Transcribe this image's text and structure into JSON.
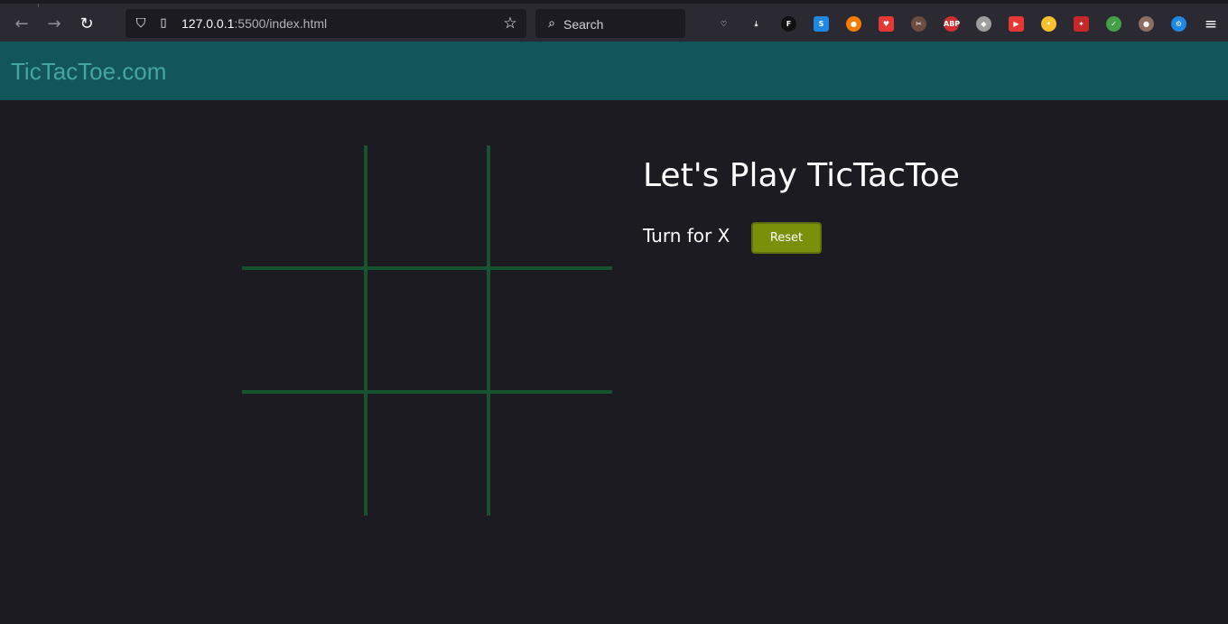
{
  "browser": {
    "url_host": "127.0.0.1",
    "url_path": ":5500/index.html",
    "search_placeholder": "Search",
    "back_glyph": "←",
    "forward_glyph": "→",
    "reload_glyph": "↻",
    "menu_glyph": "≡",
    "star_glyph": "☆",
    "search_glyph": "⌕",
    "extensions": [
      {
        "name": "pocket-icon",
        "label": "♡",
        "color": "#2b2a33"
      },
      {
        "name": "download-icon",
        "label": "⤓",
        "color": "#2b2a33"
      },
      {
        "name": "extension-f-icon",
        "label": "F",
        "color": "#111111"
      },
      {
        "name": "extension-s-icon",
        "label": "S",
        "color": "#1e88e5"
      },
      {
        "name": "extension-circle-icon",
        "label": "●",
        "color": "#f57c00"
      },
      {
        "name": "extension-youtube-heart-icon",
        "label": "♥",
        "color": "#e53935"
      },
      {
        "name": "extension-tools-icon",
        "label": "✂",
        "color": "#6d4c41"
      },
      {
        "name": "adblock-plus-icon",
        "label": "ABP",
        "color": "#d32f2f"
      },
      {
        "name": "shield-extension-icon",
        "label": "◆",
        "color": "#9e9e9e"
      },
      {
        "name": "youtube-extension-icon",
        "label": "▶",
        "color": "#e53935"
      },
      {
        "name": "color-dots-icon",
        "label": "•",
        "color": "#fbc02d"
      },
      {
        "name": "magic-wand-icon",
        "label": "✦",
        "color": "#c62828"
      },
      {
        "name": "green-shield-icon",
        "label": "✓",
        "color": "#43a047"
      },
      {
        "name": "cookie-icon",
        "label": "●",
        "color": "#8d6e63"
      },
      {
        "name": "page-translate-icon",
        "label": "⚙",
        "color": "#1e88e5"
      }
    ]
  },
  "navbar": {
    "brand": "TicTacToe.com"
  },
  "game": {
    "heading": "Let's Play TicTacToe",
    "turn_text": "Turn for X",
    "reset_label": "Reset",
    "cells": [
      "",
      "",
      "",
      "",
      "",
      "",
      "",
      "",
      ""
    ],
    "grid_color": "#16532e"
  },
  "colors": {
    "background": "#1c1b22",
    "navbar": "#12555a",
    "brand": "#45a6a1",
    "reset_button": "#7a900a"
  }
}
